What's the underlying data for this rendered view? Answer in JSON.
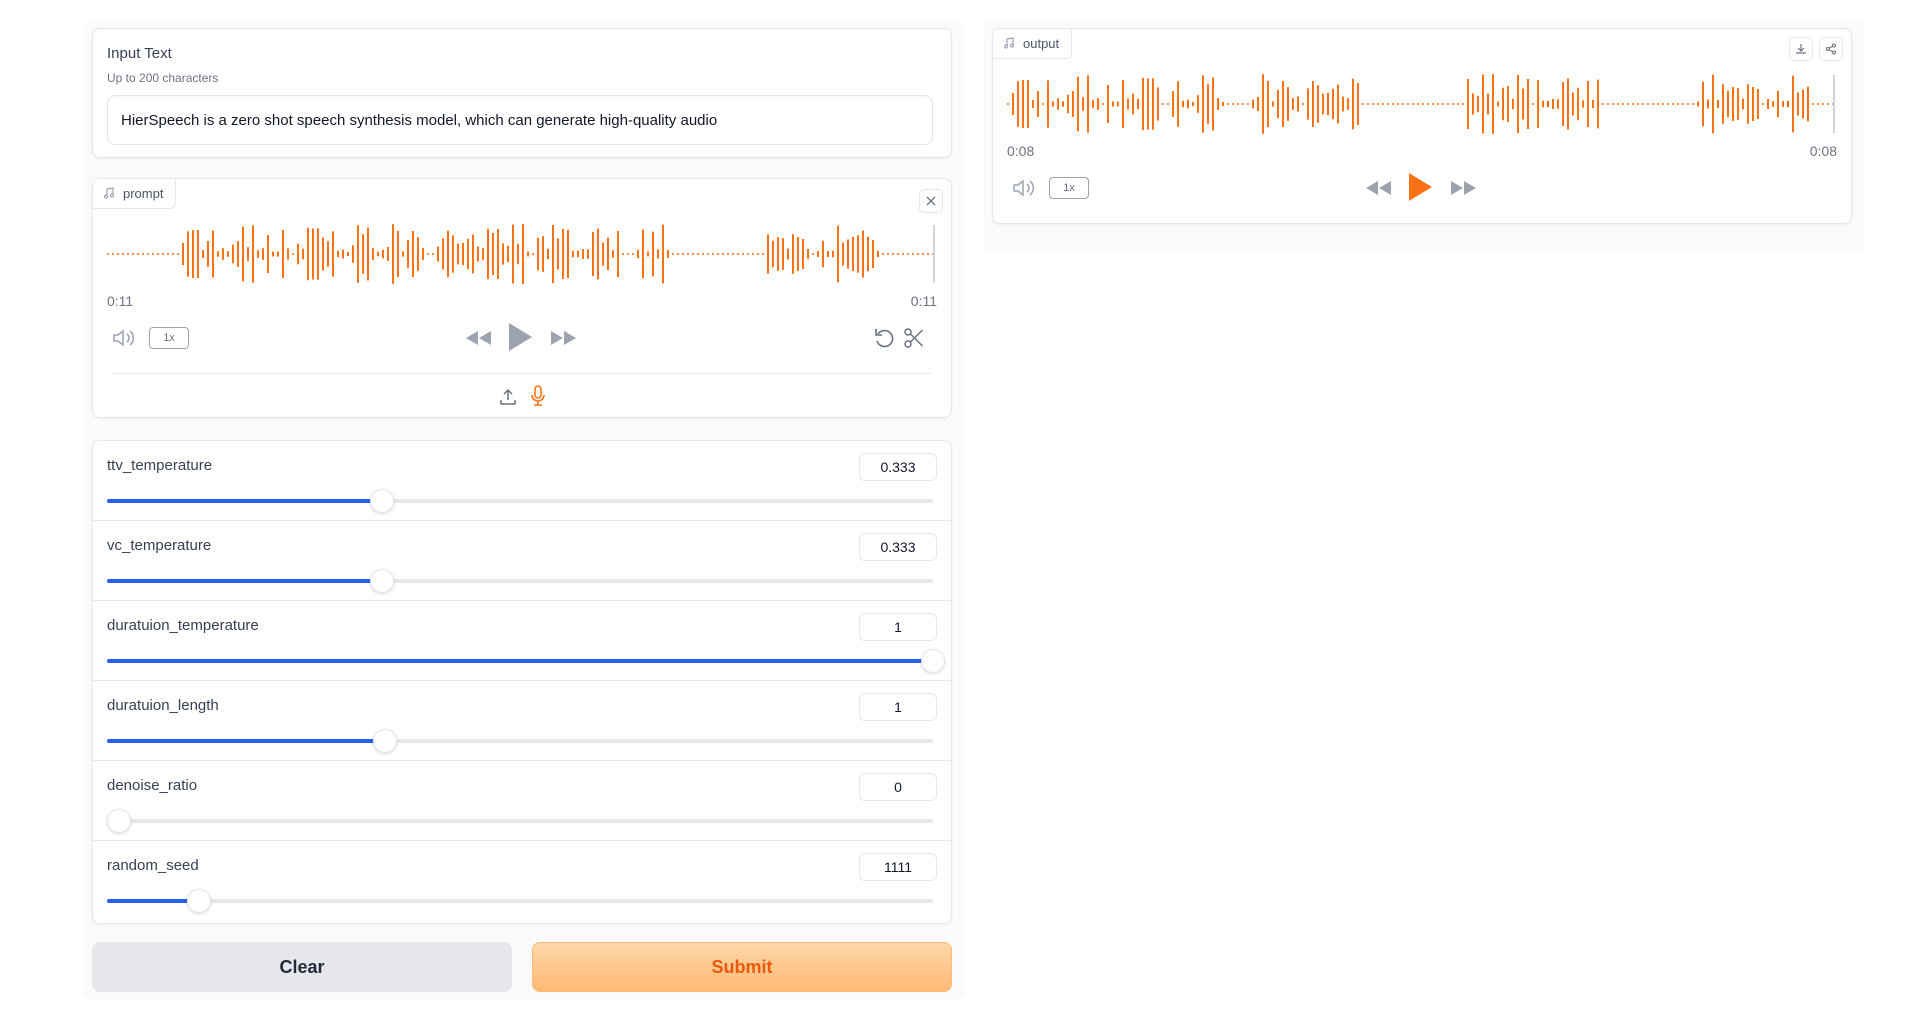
{
  "input_text": {
    "label": "Input Text",
    "info": "Up to 200 characters",
    "value": "HierSpeech is a zero shot speech synthesis model, which can generate high-quality audio"
  },
  "prompt_audio": {
    "label": "prompt",
    "current_time": "0:11",
    "duration": "0:11",
    "speed": "1x"
  },
  "sliders": [
    {
      "label": "ttv_temperature",
      "value": "0.333",
      "fill": 0.333
    },
    {
      "label": "vc_temperature",
      "value": "0.333",
      "fill": 0.333
    },
    {
      "label": "duratuion_temperature",
      "value": "1",
      "fill": 1.0
    },
    {
      "label": "duratuion_length",
      "value": "1",
      "fill": 0.337
    },
    {
      "label": "denoise_ratio",
      "value": "0",
      "fill": 0.0
    },
    {
      "label": "random_seed",
      "value": "1111",
      "fill": 0.111
    }
  ],
  "buttons": {
    "clear": "Clear",
    "submit": "Submit"
  },
  "output_audio": {
    "label": "output",
    "current_time": "0:08",
    "duration": "0:08",
    "speed": "1x"
  },
  "colors": {
    "accent": "#f97316",
    "slider": "#2563eb"
  }
}
